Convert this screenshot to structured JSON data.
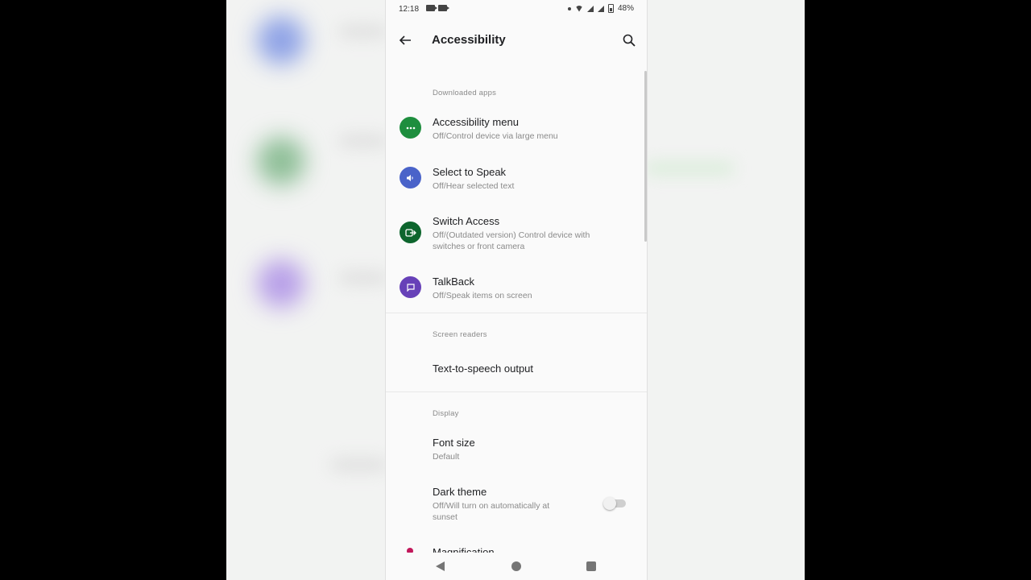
{
  "status_bar": {
    "time": "12:18",
    "battery": "48%"
  },
  "app_bar": {
    "title": "Accessibility",
    "back_icon": "arrow-back-icon",
    "search_icon": "search-icon"
  },
  "sections": {
    "downloaded_apps": "Downloaded apps",
    "screen_readers": "Screen readers",
    "display": "Display"
  },
  "items": {
    "accessibility_menu": {
      "title": "Accessibility menu",
      "subtitle": "Off/Control device via large menu",
      "icon": "more-dots-icon",
      "color": "#1e8e3e"
    },
    "select_to_speak": {
      "title": "Select to Speak",
      "subtitle": "Off/Hear selected text",
      "icon": "speaker-icon",
      "color": "#4a63c9"
    },
    "switch_access": {
      "title": "Switch Access",
      "subtitle": "Off/(Outdated version) Control device with switches or front camera",
      "icon": "switch-icon",
      "color": "#0d652d"
    },
    "talkback": {
      "title": "TalkBack",
      "subtitle": "Off/Speak items on screen",
      "icon": "chat-icon",
      "color": "#6741b8"
    },
    "tts_output": {
      "title": "Text-to-speech output"
    },
    "font_size": {
      "title": "Font size",
      "subtitle": "Default"
    },
    "dark_theme": {
      "title": "Dark theme",
      "subtitle": "Off/Will turn on automatically at sunset",
      "enabled": false
    },
    "magnification": {
      "title": "Magnification"
    }
  }
}
